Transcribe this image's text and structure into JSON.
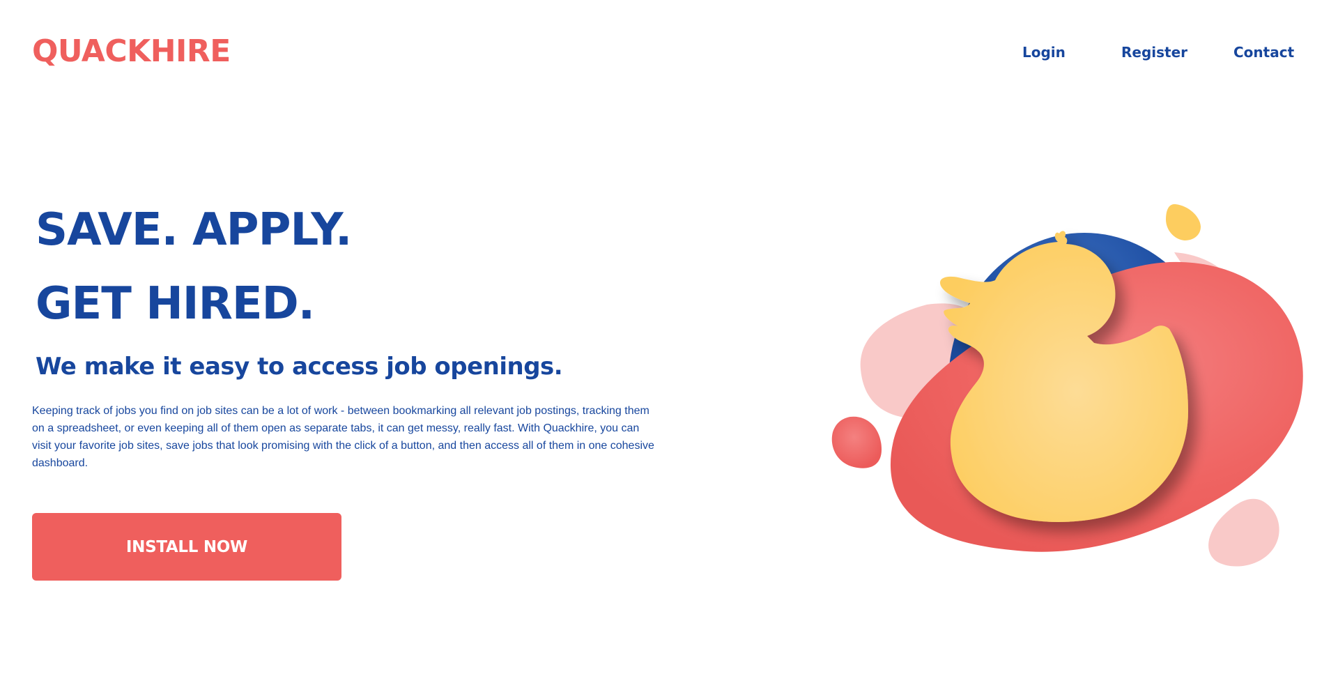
{
  "brand": {
    "name": "QUACKHIRE"
  },
  "nav": {
    "login": "Login",
    "register": "Register",
    "contact": "Contact"
  },
  "hero": {
    "line1": "SAVE. APPLY.",
    "line2": "GET HIRED.",
    "subtitle": "We make it easy to access job openings.",
    "description": "Keeping track of jobs you find on job sites can be a lot of work - between bookmarking all relevant job postings, tracking them on a spreadsheet, or even keeping all of them open as separate tabs, it can get messy, really fast. With Quackhire, you can visit your favorite job sites, save jobs that look promising with the click of a button, and then access all of them in one cohesive dashboard.",
    "cta": "INSTALL NOW"
  },
  "colors": {
    "brand_red": "#ef5f5d",
    "brand_blue": "#17469d",
    "duck_yellow": "#fdd06b",
    "blob_pink": "#f9c9c8"
  },
  "illustration": {
    "icon": "rubber-duck-illustration"
  }
}
